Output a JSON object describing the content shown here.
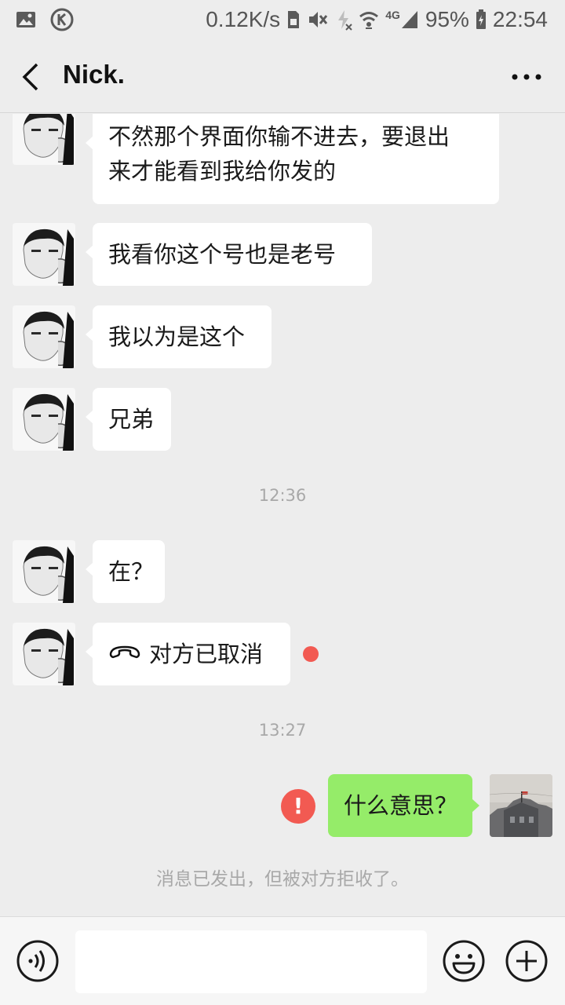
{
  "status_bar": {
    "speed": "0.12K/s",
    "network": "4G",
    "battery": "95%",
    "time": "22:54",
    "icons": [
      "gallery-icon",
      "k-app-icon",
      "sim-icon",
      "mute-icon",
      "no-charge-icon",
      "wifi-icon",
      "signal-icon",
      "battery-icon"
    ]
  },
  "header": {
    "title": "Nick.",
    "back_icon": "chevron-left-icon",
    "more_icon": "more-dots-icon"
  },
  "messages": [
    {
      "from": "contact",
      "lines": [
        "不然那个界面你输不进去，要退出",
        "来才能看到我给你发的"
      ]
    },
    {
      "from": "contact",
      "text": "我看你这个号也是老号"
    },
    {
      "from": "contact",
      "text": "我以为是这个"
    },
    {
      "from": "contact",
      "text": "兄弟"
    },
    {
      "type": "time",
      "text": "12:36"
    },
    {
      "from": "contact",
      "text": "在？"
    },
    {
      "from": "contact",
      "type": "call",
      "icon": "phone-hangup-icon",
      "text": "对方已取消",
      "unread": true
    },
    {
      "type": "time",
      "text": "13:27"
    },
    {
      "from": "me",
      "text": "什么意思？",
      "failed": true,
      "failed_icon_text": "!"
    },
    {
      "type": "system",
      "text": "消息已发出，但被对方拒收了。"
    }
  ],
  "input_bar": {
    "voice_icon": "voice-icon",
    "emoji_icon": "emoji-icon",
    "plus_icon": "plus-icon",
    "value": ""
  },
  "colors": {
    "background": "#ededed",
    "bubble_received": "#ffffff",
    "bubble_sent": "#95ec69",
    "alert": "#f25a52",
    "meta_text": "#a8a8a8"
  }
}
